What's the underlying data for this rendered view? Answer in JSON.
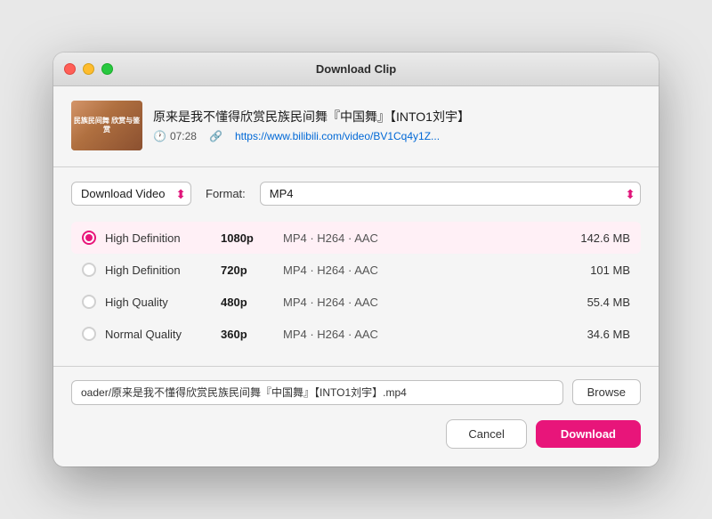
{
  "window": {
    "title": "Download Clip"
  },
  "video": {
    "title": "原来是我不懂得欣赏民族民间舞『中国舞』【INTO1刘宇】",
    "duration": "07:28",
    "link": "https://www.bilibili.com/video/BV1Cq4y1Z...",
    "thumbnail_text": "民族民间舞\n欣赏与鉴赏"
  },
  "controls": {
    "type_label": "Download Video",
    "format_label": "Format:",
    "format_value": "MP4"
  },
  "quality_options": [
    {
      "id": "hd1080",
      "name": "High Definition",
      "resolution": "1080p",
      "codec": "MP4 · H264 · AAC",
      "size": "142.6 MB",
      "selected": true
    },
    {
      "id": "hd720",
      "name": "High Definition",
      "resolution": "720p",
      "codec": "MP4 · H264 · AAC",
      "size": "101 MB",
      "selected": false
    },
    {
      "id": "hq480",
      "name": "High Quality",
      "resolution": "480p",
      "codec": "MP4 · H264 · AAC",
      "size": "55.4 MB",
      "selected": false
    },
    {
      "id": "nq360",
      "name": "Normal Quality",
      "resolution": "360p",
      "codec": "MP4 · H264 · AAC",
      "size": "34.6 MB",
      "selected": false
    }
  ],
  "filepath": {
    "value": "oader/原来是我不懂得欣赏民族民间舞『中国舞』【INTO1刘宇】.mp4",
    "browse_label": "Browse"
  },
  "buttons": {
    "cancel": "Cancel",
    "download": "Download"
  }
}
